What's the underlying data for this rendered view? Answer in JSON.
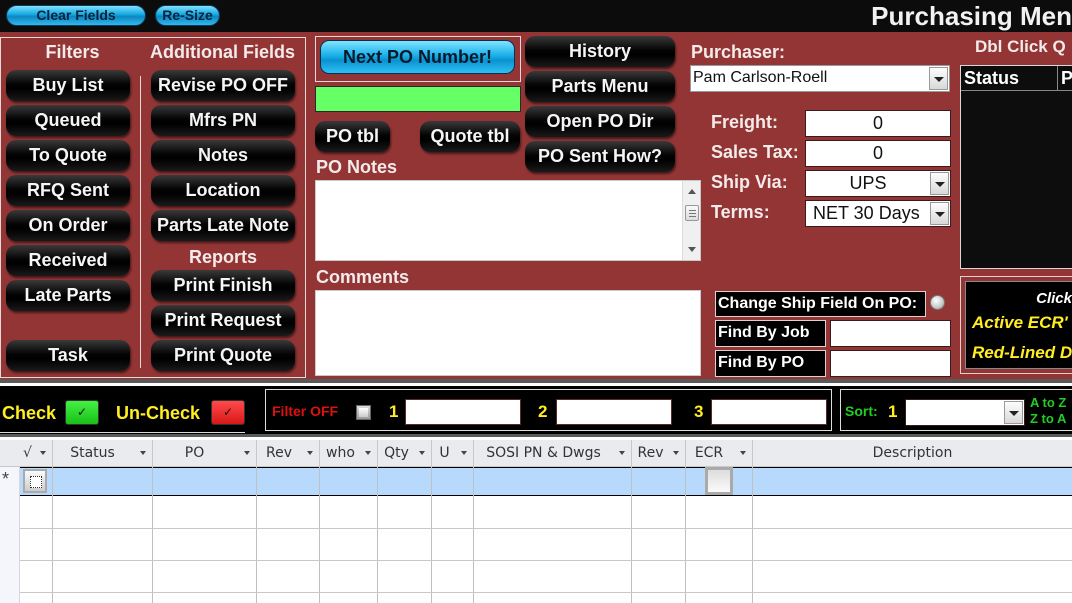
{
  "topbar": {
    "clear_fields": "Clear Fields",
    "resize": "Re-Size",
    "title": "Purchasing Men"
  },
  "filters": {
    "header": "Filters",
    "items": [
      "Buy List",
      "Queued",
      "To Quote",
      "RFQ Sent",
      "On Order",
      "Received",
      "Late Parts"
    ],
    "task": "Task"
  },
  "additional": {
    "header": "Additional Fields",
    "items": [
      "Revise PO OFF",
      "Mfrs PN",
      "Notes",
      "Location",
      "Parts Late Note"
    ],
    "reports_header": "Reports",
    "reports": [
      "Print Finish",
      "Print Request",
      "Print Quote"
    ]
  },
  "po": {
    "next_po": "Next PO Number!",
    "po_number_value": "",
    "po_tbl": "PO tbl",
    "quote_tbl": "Quote tbl",
    "po_notes_label": "PO Notes",
    "po_notes_value": "",
    "comments_label": "Comments",
    "comments_value": ""
  },
  "menu_buttons": [
    "History",
    "Parts Menu",
    "Open PO Dir",
    "PO Sent How?"
  ],
  "purchaser": {
    "label": "Purchaser:",
    "value": "Pam Carlson-Roell"
  },
  "costs": {
    "freight_label": "Freight:",
    "freight_value": "0",
    "tax_label": "Sales Tax:",
    "tax_value": "0",
    "ship_label": "Ship Via:",
    "ship_value": "UPS",
    "terms_label": "Terms:",
    "terms_value": "NET 30 Days"
  },
  "find": {
    "change_ship": "Change Ship Field On PO:",
    "by_job": "Find By Job",
    "by_job_value": "",
    "by_po": "Find By PO",
    "by_po_value": ""
  },
  "quotes_panel": {
    "header": "Dbl Click Q",
    "columns": [
      "Status",
      "P"
    ]
  },
  "ecr_panel": {
    "click": "Click",
    "active": "Active ECR'",
    "redlined": "Red-Lined D"
  },
  "filterbar": {
    "check": "Check",
    "uncheck": "Un-Check",
    "filter_status": "Filter OFF",
    "filter1_num": "1",
    "filter2_num": "2",
    "filter3_num": "3",
    "filter1": "",
    "filter2": "",
    "filter3": "",
    "sort_label": "Sort:",
    "sort_num": "1",
    "sort_value": "",
    "a_to_z": "A to Z",
    "z_to_a": "Z to A",
    "colors": {
      "check": "#22dd22",
      "uncheck": "#ee2222",
      "filter_off": "#dd1111",
      "yellow": "#ffee22",
      "sort_green": "#22cc22"
    }
  },
  "grid": {
    "new_record_marker": "*",
    "columns": [
      "√",
      "Status",
      "PO",
      "Rev",
      "who",
      "Qty",
      "U",
      "SOSI PN & Dwgs",
      "Rev",
      "ECR",
      "Description"
    ]
  }
}
